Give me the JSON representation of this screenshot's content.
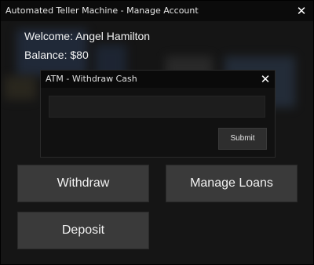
{
  "window": {
    "title": "Automated Teller Machine - Manage Account"
  },
  "account": {
    "welcome": "Welcome: Angel Hamilton",
    "balance": "Balance: $80"
  },
  "dialog": {
    "title": "ATM - Withdraw Cash",
    "amount_value": "",
    "submit_label": "Submit"
  },
  "actions": {
    "withdraw_label": "Withdraw",
    "manage_loans_label": "Manage Loans",
    "deposit_label": "Deposit"
  },
  "icons": {
    "close": "close-icon"
  },
  "colors": {
    "window_bg": "#151515",
    "button_bg": "#3a3a3a",
    "text": "#f2f2f2"
  }
}
